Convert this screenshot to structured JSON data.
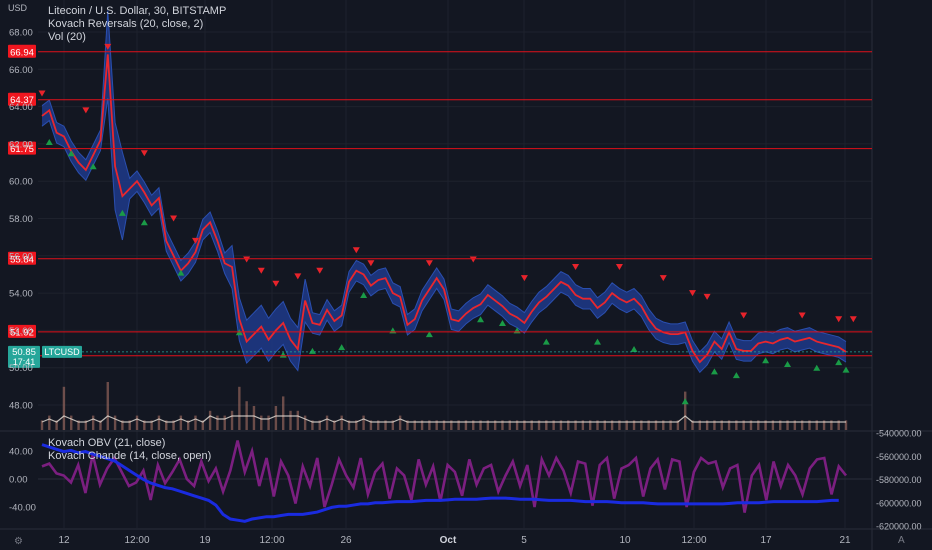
{
  "header": {
    "currency_label": "USD",
    "title_line": "Litecoin / U.S. Dollar, 30, BITSTAMP",
    "indicator_1": "Kovach Reversals (20, close, 2)",
    "indicator_2": "Vol (20)",
    "lower_indicator_1": "Kovach OBV (21, close)",
    "lower_indicator_2": "Kovach Chande (14, close, open)"
  },
  "price_axis": {
    "ticks": [
      "68.00",
      "66.00",
      "64.00",
      "62.00",
      "60.00",
      "58.00",
      "56.00",
      "54.00",
      "52.00",
      "50.00",
      "48.00"
    ],
    "tick_values": [
      68,
      66,
      64,
      62,
      60,
      58,
      56,
      54,
      52,
      50,
      48
    ]
  },
  "lower_left_axis": {
    "ticks": [
      "40.00",
      "0.00",
      "-40.00"
    ],
    "tick_values": [
      40,
      0,
      -40
    ]
  },
  "lower_right_axis": {
    "ticks": [
      "-540000.00",
      "-560000.00",
      "-580000.00",
      "-600000.00",
      "-620000.00"
    ],
    "tick_values": [
      -540000,
      -560000,
      -580000,
      -600000,
      -620000
    ]
  },
  "time_axis": {
    "labels": [
      "12",
      "12:00",
      "19",
      "12:00",
      "26",
      "Oct",
      "5",
      "10",
      "12:00",
      "17",
      "21"
    ]
  },
  "levels": [
    {
      "value": 66.94,
      "label": "66.94"
    },
    {
      "value": 64.37,
      "label": "64.37"
    },
    {
      "value": 61.75,
      "label": "61.75"
    },
    {
      "value": 55.84,
      "label": "55.84"
    },
    {
      "value": 51.92,
      "label": "51.92"
    },
    {
      "value": 50.64,
      "label": "50.64"
    }
  ],
  "current_price": {
    "value": 50.85,
    "label": "50.85",
    "countdown": "17:41",
    "symbol": "LTCUSD"
  },
  "colors": {
    "background": "#131722",
    "grid": "#1e222d",
    "level_line": "#e0101a",
    "level_badge": "#f0161f",
    "price_line": "#e8272e",
    "band": "#1e3a8a",
    "band_edge": "#2a4fb0",
    "down_marker": "#e8232b",
    "up_marker": "#1a9b47",
    "volume": "#b5786a",
    "chande": "#7b1f80",
    "obv": "#1a2be0",
    "current_badge": "#26a69a"
  },
  "chart_data": [
    {
      "type": "line",
      "title": "Litecoin / U.S. Dollar, 30, BITSTAMP",
      "ylabel": "USD",
      "ylim": [
        47,
        69
      ],
      "x_tick_labels": [
        "12",
        "12:00",
        "19",
        "12:00",
        "26",
        "Oct",
        "5",
        "10",
        "12:00",
        "17",
        "21"
      ],
      "series": [
        {
          "name": "close",
          "values": [
            63.5,
            63.8,
            62.6,
            62.4,
            61.6,
            61.0,
            60.6,
            61.4,
            62.2,
            66.8,
            60.8,
            59.2,
            59.6,
            60.0,
            59.4,
            58.7,
            59.1,
            56.8,
            56.0,
            55.2,
            55.6,
            56.2,
            57.4,
            57.8,
            56.8,
            55.6,
            55.4,
            52.6,
            51.4,
            51.8,
            52.2,
            51.5,
            52.0,
            52.4,
            51.5,
            51.0,
            53.6,
            52.4,
            52.3,
            53.1,
            52.5,
            52.8,
            54.6,
            55.2,
            55.0,
            54.4,
            54.7,
            54.8,
            54.0,
            53.8,
            52.3,
            52.6,
            53.6,
            54.2,
            54.8,
            54.2,
            52.6,
            52.5,
            52.9,
            53.2,
            53.4,
            53.9,
            53.6,
            53.3,
            52.9,
            52.7,
            52.4,
            53.0,
            53.5,
            53.8,
            54.2,
            54.6,
            54.4,
            53.9,
            53.7,
            53.7,
            53.2,
            53.5,
            54.0,
            53.7,
            53.5,
            53.7,
            53.3,
            52.6,
            52.1,
            51.9,
            51.8,
            51.8,
            51.9,
            50.9,
            50.3,
            50.7,
            51.4,
            51.0,
            51.9,
            51.0,
            50.9,
            50.9,
            51.3,
            51.4,
            51.3,
            51.5,
            51.6,
            51.4,
            51.5,
            51.6,
            51.4,
            51.3,
            51.2,
            51.1,
            50.85
          ]
        }
      ],
      "reversal_markers": {
        "down": [
          [
            0,
            64.7
          ],
          [
            6,
            63.8
          ],
          [
            9,
            67.2
          ],
          [
            14,
            61.5
          ],
          [
            18,
            58.0
          ],
          [
            21,
            56.8
          ],
          [
            28,
            55.8
          ],
          [
            30,
            55.2
          ],
          [
            32,
            54.5
          ],
          [
            35,
            54.9
          ],
          [
            38,
            55.2
          ],
          [
            43,
            56.3
          ],
          [
            45,
            55.6
          ],
          [
            53,
            55.6
          ],
          [
            59,
            55.8
          ],
          [
            66,
            54.8
          ],
          [
            73,
            55.4
          ],
          [
            79,
            55.4
          ],
          [
            85,
            54.8
          ],
          [
            89,
            54.0
          ],
          [
            91,
            53.8
          ],
          [
            96,
            52.8
          ],
          [
            104,
            52.8
          ],
          [
            109,
            52.6
          ],
          [
            111,
            52.6
          ]
        ],
        "up": [
          [
            1,
            62.1
          ],
          [
            4,
            61.5
          ],
          [
            7,
            60.8
          ],
          [
            11,
            58.3
          ],
          [
            14,
            57.8
          ],
          [
            19,
            55.1
          ],
          [
            27,
            51.9
          ],
          [
            33,
            50.7
          ],
          [
            37,
            50.9
          ],
          [
            41,
            51.1
          ],
          [
            44,
            53.9
          ],
          [
            48,
            52.0
          ],
          [
            53,
            51.8
          ],
          [
            60,
            52.6
          ],
          [
            63,
            52.4
          ],
          [
            65,
            52.0
          ],
          [
            69,
            51.4
          ],
          [
            76,
            51.4
          ],
          [
            81,
            51.0
          ],
          [
            88,
            48.2
          ],
          [
            92,
            49.8
          ],
          [
            95,
            49.6
          ],
          [
            99,
            50.4
          ],
          [
            102,
            50.2
          ],
          [
            106,
            50.0
          ],
          [
            109,
            50.3
          ],
          [
            110,
            49.9
          ]
        ]
      },
      "levels": [
        66.94,
        64.37,
        61.75,
        55.84,
        51.92,
        50.64
      ]
    },
    {
      "type": "bar",
      "title": "Vol (20)",
      "note": "volume histogram (relative units)",
      "values": [
        2,
        3,
        2,
        9,
        3,
        2,
        2,
        3,
        2,
        10,
        3,
        2,
        2,
        3,
        2,
        2,
        3,
        2,
        2,
        3,
        2,
        3,
        2,
        4,
        3,
        3,
        4,
        9,
        6,
        5,
        3,
        3,
        5,
        7,
        4,
        4,
        3,
        2,
        2,
        3,
        2,
        3,
        2,
        2,
        3,
        2,
        2,
        2,
        2,
        3,
        2,
        2,
        2,
        2,
        2,
        2,
        2,
        2,
        2,
        2,
        2,
        2,
        2,
        2,
        2,
        2,
        2,
        2,
        2,
        2,
        2,
        2,
        2,
        2,
        2,
        2,
        2,
        2,
        2,
        2,
        2,
        2,
        2,
        2,
        2,
        2,
        2,
        2,
        8,
        2,
        2,
        2,
        2,
        2,
        2,
        2,
        2,
        2,
        2,
        2,
        2,
        2,
        2,
        2,
        2,
        2,
        2,
        2,
        2,
        2,
        2
      ]
    },
    {
      "type": "line",
      "title": "Kovach Chande (14, close, open)",
      "ylim": [
        -60,
        60
      ],
      "series": [
        {
          "name": "Kovach Chande (14, close, open)",
          "values": [
            18,
            22,
            8,
            5,
            -5,
            20,
            -20,
            35,
            -8,
            15,
            30,
            10,
            -10,
            -5,
            12,
            -30,
            20,
            -6,
            10,
            28,
            0,
            -10,
            25,
            -3,
            15,
            -18,
            12,
            55,
            10,
            40,
            -10,
            30,
            -25,
            25,
            5,
            -35,
            18,
            -10,
            30,
            -40,
            -8,
            28,
            5,
            -12,
            30,
            -22,
            10,
            22,
            -28,
            15,
            5,
            -30,
            28,
            -8,
            18,
            -32,
            20,
            10,
            -24,
            28,
            -8,
            15,
            20,
            -18,
            5,
            25,
            -10,
            20,
            -40,
            28,
            5,
            30,
            12,
            -20,
            25,
            22,
            -38,
            20,
            30,
            -28,
            15,
            20,
            30,
            -25,
            15,
            28,
            -15,
            28,
            25,
            -40,
            10,
            30,
            22,
            25,
            -12,
            15,
            20,
            -48,
            5,
            20,
            -30,
            25,
            -10,
            20,
            5,
            -22,
            15,
            28,
            30,
            -22,
            18,
            5
          ]
        },
        {
          "name": "Kovach OBV (21, close)",
          "values": [
            -550000,
            -552000,
            -554000,
            -556000,
            -555000,
            -557000,
            -556000,
            -558000,
            -560000,
            -562000,
            -564000,
            -568000,
            -572000,
            -576000,
            -580000,
            -583000,
            -585000,
            -587000,
            -588000,
            -590000,
            -592000,
            -594000,
            -596000,
            -598000,
            -602000,
            -610000,
            -614000,
            -615000,
            -616000,
            -614000,
            -613000,
            -612000,
            -612000,
            -611000,
            -610000,
            -610000,
            -610000,
            -609000,
            -608000,
            -606000,
            -604000,
            -603000,
            -603000,
            -602000,
            -601000,
            -601000,
            -600000,
            -600000,
            -599500,
            -599000,
            -599000,
            -599000,
            -598500,
            -598000,
            -598000,
            -598000,
            -597500,
            -597000,
            -597000,
            -597000,
            -597000,
            -596500,
            -596000,
            -596000,
            -596000,
            -596500,
            -597000,
            -597000,
            -597000,
            -597500,
            -598000,
            -598000,
            -598000,
            -598000,
            -598500,
            -599000,
            -599000,
            -599000,
            -599000,
            -599500,
            -600000,
            -600000,
            -600000,
            -600000,
            -600500,
            -601000,
            -601000,
            -601000,
            -601000,
            -601000,
            -601000,
            -601000,
            -601000,
            -601000,
            -601000,
            -600500,
            -600000,
            -600000,
            -600000,
            -600000,
            -599500,
            -599000,
            -599000,
            -599000,
            -599000,
            -599000,
            -599000,
            -599000,
            -598500,
            -598000,
            -598000
          ]
        }
      ]
    }
  ]
}
